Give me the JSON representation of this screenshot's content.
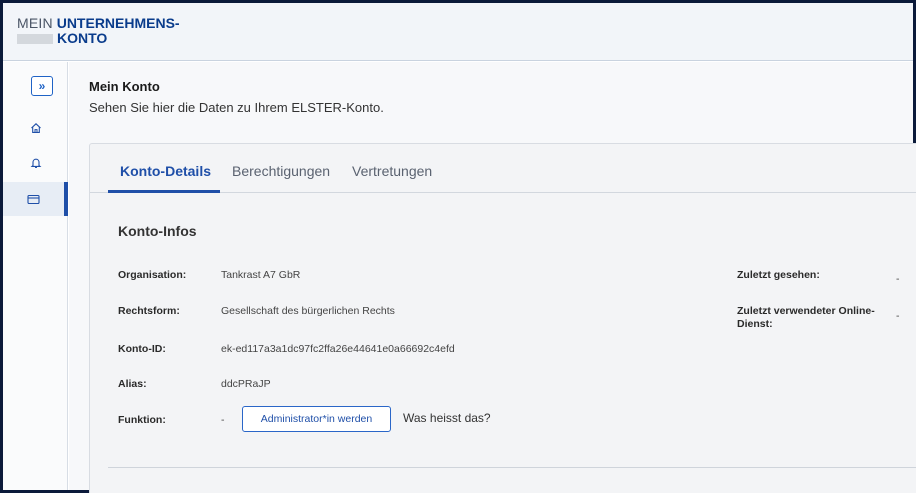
{
  "header": {
    "logo_line1_light": "MEIN",
    "logo_line1_bold": "UNTERNEHMENS-",
    "logo_line2_bold": "KONTO"
  },
  "sidebar": {
    "toggle_glyph": "»",
    "items": [
      {
        "icon": "home-icon",
        "active": false
      },
      {
        "icon": "bell-icon",
        "active": false
      },
      {
        "icon": "credit-card-icon",
        "active": true
      }
    ]
  },
  "page": {
    "title": "Mein Konto",
    "subtitle": "Sehen Sie hier die Daten zu Ihrem ELSTER-Konto."
  },
  "tabs": [
    {
      "label": "Konto-Details",
      "active": true
    },
    {
      "label": "Berechtigungen",
      "active": false
    },
    {
      "label": "Vertretungen",
      "active": false
    }
  ],
  "konto_infos": {
    "title": "Konto-Infos",
    "organisation_label": "Organisation:",
    "organisation_value": "Tankrast A7 GbR",
    "rechtsform_label": "Rechtsform:",
    "rechtsform_value": "Gesellschaft des bürgerlichen Rechts",
    "konto_id_label": "Konto-ID:",
    "konto_id_value": "ek-ed117a3a1dc97fc2ffa26e44641e0a66692c4efd",
    "alias_label": "Alias:",
    "alias_value": "ddcPRaJP",
    "funktion_label": "Funktion:",
    "funktion_value": "-",
    "admin_button": "Administrator*in werden",
    "help_link": "Was heisst das?",
    "zuletzt_gesehen_label": "Zuletzt gesehen:",
    "zuletzt_gesehen_value": "-",
    "zuletzt_dienst_label": "Zuletzt verwendeter Online-Dienst:",
    "zuletzt_dienst_value": "-"
  },
  "colors": {
    "accent": "#1f4fa8",
    "brand_dark": "#0a3c8c",
    "frame": "#0b1a3a"
  }
}
